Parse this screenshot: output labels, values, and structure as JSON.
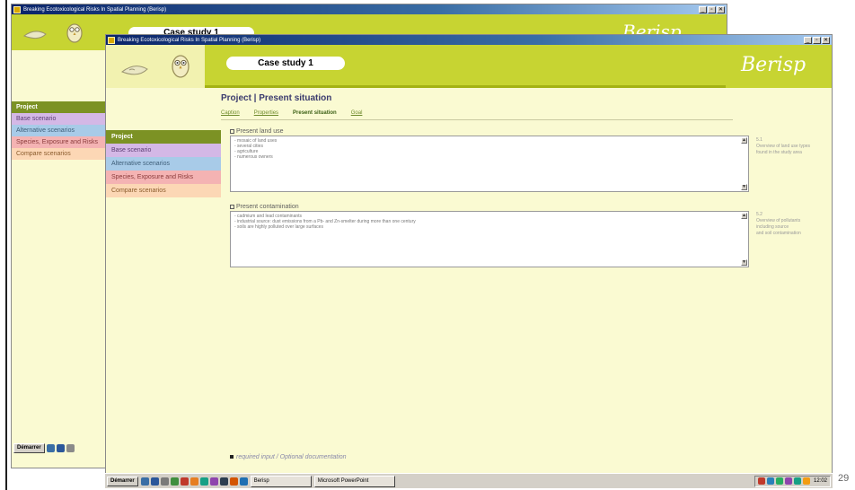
{
  "window": {
    "title": "Breaking Ecotoxicological Risks In Spatial Planning (Berisp)",
    "controls": [
      "_",
      "▫",
      "✕"
    ]
  },
  "header": {
    "case_study_label": "Case study 1",
    "brand": "Berisp"
  },
  "sidebar": {
    "items": [
      {
        "label": "Project",
        "color": "#7c9224"
      },
      {
        "label": "Base scenario",
        "color": "#d4b8e6"
      },
      {
        "label": "Alternative scenarios",
        "color": "#a8cbe8"
      },
      {
        "label": "Species, Exposure and Risks",
        "color": "#f4b3b3"
      },
      {
        "label": "Compare scenarios",
        "color": "#fcd7b5"
      }
    ]
  },
  "main": {
    "title": "Project | Present situation",
    "tabs": [
      "Caption",
      "Properties",
      "Present situation",
      "Goal"
    ],
    "active_tab": "Present situation",
    "sections": [
      {
        "label": "Present land use",
        "lines": [
          "- mosaic of land uses",
          "- several cities",
          "- agriculture",
          "- numerous owners"
        ],
        "side_note": [
          "5.1",
          "Overview of land use types",
          "found in the study area"
        ]
      },
      {
        "label": "Present contamination",
        "lines": [
          "- cadmium and lead contaminants",
          "- industrial source: dust emissions from a Pb- and Zn-smelter during more than one century",
          "- soils are highly polluted over large surfaces"
        ],
        "side_note": [
          "5.2",
          "Overview of pollutants",
          "including source",
          "and soil contamination"
        ]
      }
    ],
    "footnote": "required input / Optional documentation"
  },
  "taskbar": {
    "start_label": "Démarrer",
    "tasks": [
      "Berisp",
      "Microsoft PowerPoint"
    ],
    "clock": "12:02"
  },
  "slide_number": "29",
  "colors": {
    "header_green": "#c7d432",
    "page_bg": "#fafad2",
    "title_text": "#3b3b6e"
  }
}
